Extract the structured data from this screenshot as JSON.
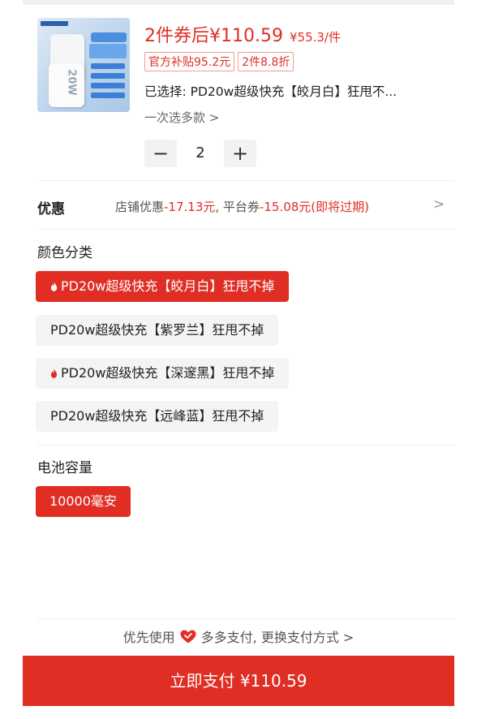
{
  "product": {
    "price_main": "2件券后¥110.59",
    "price_per": "¥55.3/件",
    "tags": [
      "官方补贴95.2元",
      "2件8.8折"
    ],
    "selected_text": "已选择: PD20w超级快充【皎月白】狂甩不...",
    "multi_select": "一次选多款 >",
    "quantity": "2",
    "minus": "−",
    "plus": "+"
  },
  "promo": {
    "label": "优惠",
    "store_prefix": "店铺优惠",
    "store_amount": "-17.13元",
    "platform_prefix": ", 平台券",
    "platform_amount": "-15.08元(即将过期)",
    "arrow": ">"
  },
  "color_section": {
    "title": "颜色分类",
    "options": [
      {
        "label": "PD20w超级快充【皎月白】狂甩不掉",
        "selected": true,
        "hot": true
      },
      {
        "label": "PD20w超级快充【紫罗兰】狂甩不掉",
        "selected": false,
        "hot": false
      },
      {
        "label": "PD20w超级快充【深邃黑】狂甩不掉",
        "selected": false,
        "hot": true
      },
      {
        "label": "PD20w超级快充【远峰蓝】狂甩不掉",
        "selected": false,
        "hot": false
      }
    ]
  },
  "capacity_section": {
    "title": "电池容量",
    "options": [
      {
        "label": "10000毫安",
        "selected": true
      }
    ]
  },
  "payment": {
    "prefix": "优先使用",
    "method": "多多支付, 更换支付方式 >",
    "button_label": "立即支付 ¥110.59"
  },
  "colors": {
    "accent": "#e02e24",
    "option_bg": "#f4f4f4"
  }
}
